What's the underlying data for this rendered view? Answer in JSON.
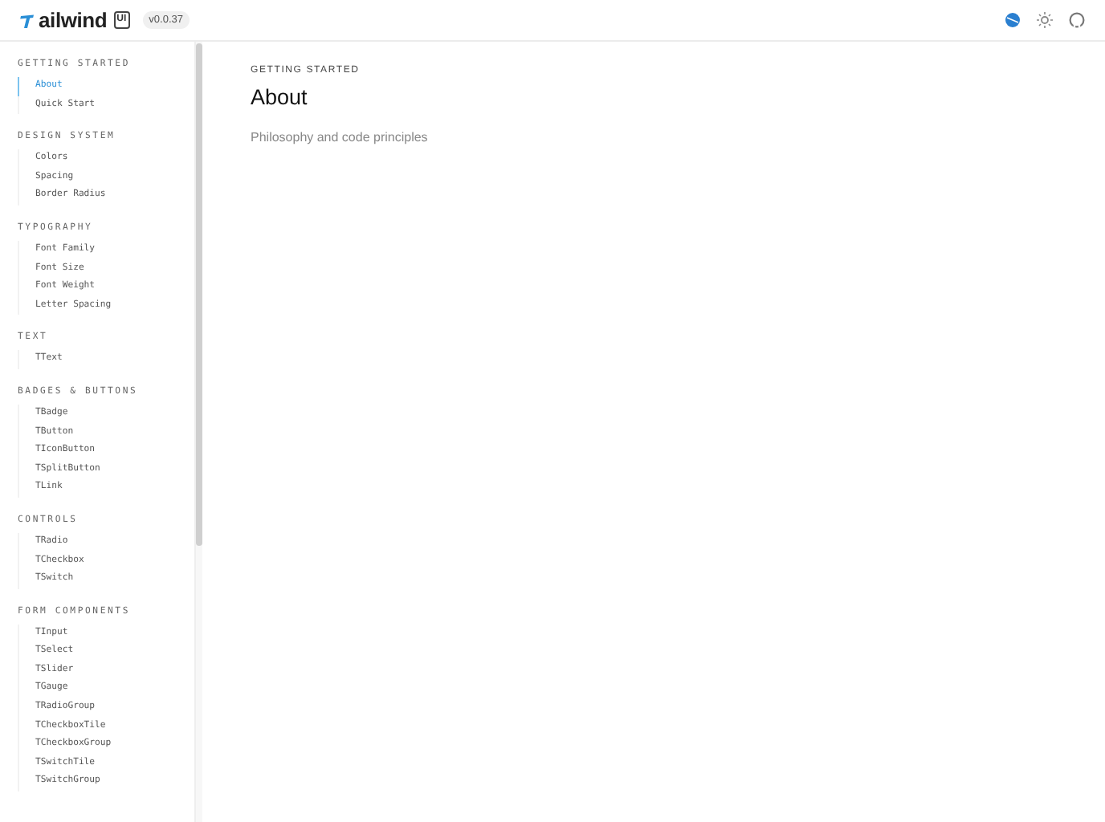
{
  "header": {
    "logo_text": "ailwind",
    "logo_badge": "UI",
    "version": "v0.0.37"
  },
  "sidebar": {
    "sections": [
      {
        "title": "GETTING STARTED",
        "items": [
          {
            "label": "About",
            "selected": true
          },
          {
            "label": "Quick Start",
            "selected": false
          }
        ]
      },
      {
        "title": "DESIGN SYSTEM",
        "items": [
          {
            "label": "Colors",
            "selected": false
          },
          {
            "label": "Spacing",
            "selected": false
          },
          {
            "label": "Border Radius",
            "selected": false
          }
        ]
      },
      {
        "title": "TYPOGRAPHY",
        "items": [
          {
            "label": "Font Family",
            "selected": false
          },
          {
            "label": "Font Size",
            "selected": false
          },
          {
            "label": "Font Weight",
            "selected": false
          },
          {
            "label": "Letter Spacing",
            "selected": false
          }
        ]
      },
      {
        "title": "TEXT",
        "items": [
          {
            "label": "TText",
            "selected": false
          }
        ]
      },
      {
        "title": "BADGES & BUTTONS",
        "items": [
          {
            "label": "TBadge",
            "selected": false
          },
          {
            "label": "TButton",
            "selected": false
          },
          {
            "label": "TIconButton",
            "selected": false
          },
          {
            "label": "TSplitButton",
            "selected": false
          },
          {
            "label": "TLink",
            "selected": false
          }
        ]
      },
      {
        "title": "CONTROLS",
        "items": [
          {
            "label": "TRadio",
            "selected": false
          },
          {
            "label": "TCheckbox",
            "selected": false
          },
          {
            "label": "TSwitch",
            "selected": false
          }
        ]
      },
      {
        "title": "FORM COMPONENTS",
        "items": [
          {
            "label": "TInput",
            "selected": false
          },
          {
            "label": "TSelect",
            "selected": false
          },
          {
            "label": "TSlider",
            "selected": false
          },
          {
            "label": "TGauge",
            "selected": false
          },
          {
            "label": "TRadioGroup",
            "selected": false
          },
          {
            "label": "TCheckboxTile",
            "selected": false
          },
          {
            "label": "TCheckboxGroup",
            "selected": false
          },
          {
            "label": "TSwitchTile",
            "selected": false
          },
          {
            "label": "TSwitchGroup",
            "selected": false
          }
        ]
      }
    ]
  },
  "main": {
    "eyebrow": "GETTING STARTED",
    "title": "About",
    "subtitle": "Philosophy and code principles"
  }
}
